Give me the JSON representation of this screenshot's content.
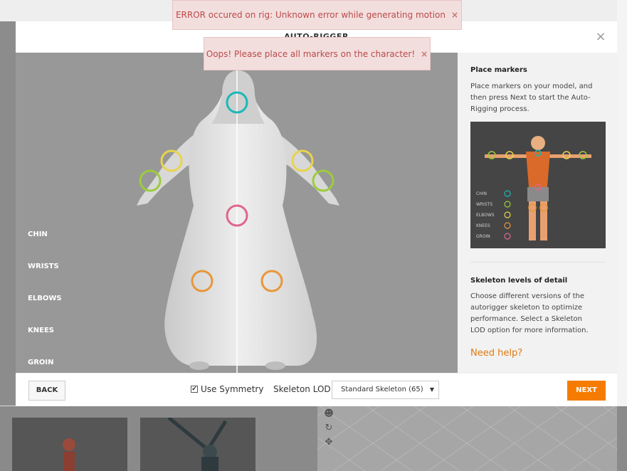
{
  "modal": {
    "title": "AUTO-RIGGER",
    "close_label": "×"
  },
  "markers": {
    "labels": [
      "CHIN",
      "WRISTS",
      "ELBOWS",
      "KNEES",
      "GROIN"
    ],
    "colors": {
      "chin": "#1ab8b8",
      "wrists": "#9ccc3c",
      "elbows": "#e8d44d",
      "knees": "#e8973a",
      "groin": "#e0668a"
    }
  },
  "sidebar": {
    "place_heading": "Place markers",
    "place_text": "Place markers on your model, and then press Next to start the Auto-Rigging process.",
    "ref_labels": [
      "CHIN",
      "WRISTS",
      "ELBOWS",
      "KNEES",
      "GROIN"
    ],
    "lod_heading": "Skeleton levels of detail",
    "lod_text": "Choose different versions of the autorigger skeleton to optimize performance. Select a Skeleton LOD option for more information.",
    "help_link": "Need help?"
  },
  "footer": {
    "back_label": "BACK",
    "symmetry_label": "Use Symmetry",
    "symmetry_checked": true,
    "lod_label": "Skeleton LOD",
    "lod_selected": "Standard Skeleton (65)",
    "next_label": "NEXT"
  },
  "toasts": {
    "error": "ERROR occured on rig: Unknown error while generating motion",
    "warning": "Oops! Please place all markers on the character!",
    "close_icon": "×"
  },
  "colors": {
    "accent": "#f57c00",
    "toast_bg": "#f3dede",
    "toast_text": "#b94a48"
  }
}
